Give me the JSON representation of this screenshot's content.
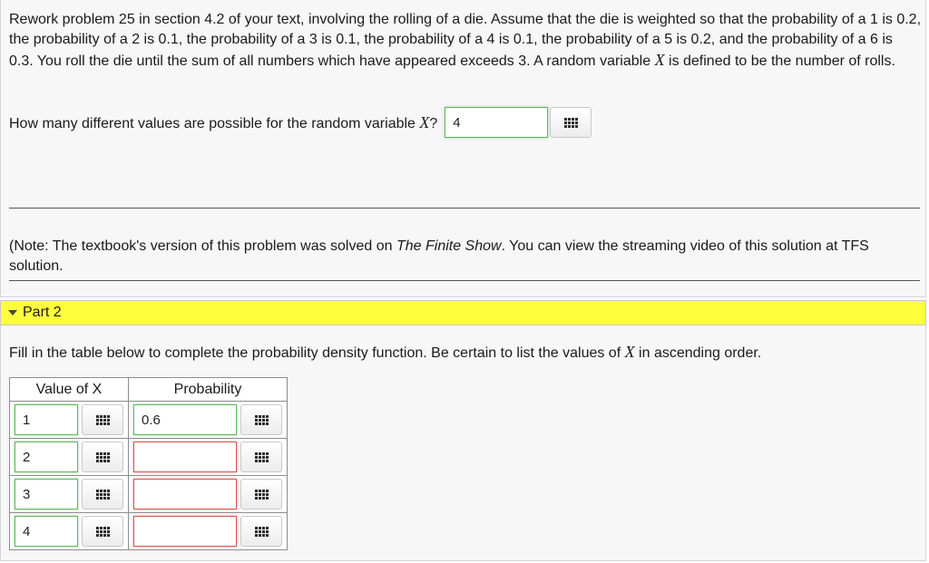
{
  "part1": {
    "problem_text": [
      "Rework problem 25 in section 4.2 of your text, involving the rolling of a die. Assume that the die is weighted so that the probability of a 1 is 0.2, the probability of a 2 is 0.1, the probability of a 3 is 0.1, the probability of a 4 is 0.1, the probability of a 5 is 0.2, and the probability of a 6 is 0.3. You roll the die until the sum of all numbers which have appeared exceeds 3. A random variable ",
      "X",
      " is defined to be the number of rolls."
    ],
    "question": {
      "prefix": "How many different values are possible for the random variable ",
      "variable": "X",
      "suffix": "?",
      "answer": "4"
    },
    "note": {
      "before": "(Note: The textbook's version of this problem was solved on ",
      "show_name": "The Finite Show",
      "after": ". You can view the streaming video of this solution at TFS solution."
    }
  },
  "part2": {
    "label": "Part 2",
    "instructions": {
      "prefix": "Fill in the table below to complete the probability density function. Be certain to list the values of ",
      "variable": "X",
      "suffix": " in ascending order."
    },
    "table": {
      "headers": [
        "Value of X",
        "Probability"
      ],
      "rows": [
        {
          "x": "1",
          "p": "0.6"
        },
        {
          "x": "2",
          "p": ""
        },
        {
          "x": "3",
          "p": ""
        },
        {
          "x": "4",
          "p": ""
        }
      ]
    }
  },
  "icons": {
    "palette": "grid-icon",
    "collapse": "triangle-down-icon"
  },
  "colors": {
    "part_header": "#ffff3d",
    "valid_border": "#5cb85c",
    "invalid_border": "#d9534f"
  }
}
